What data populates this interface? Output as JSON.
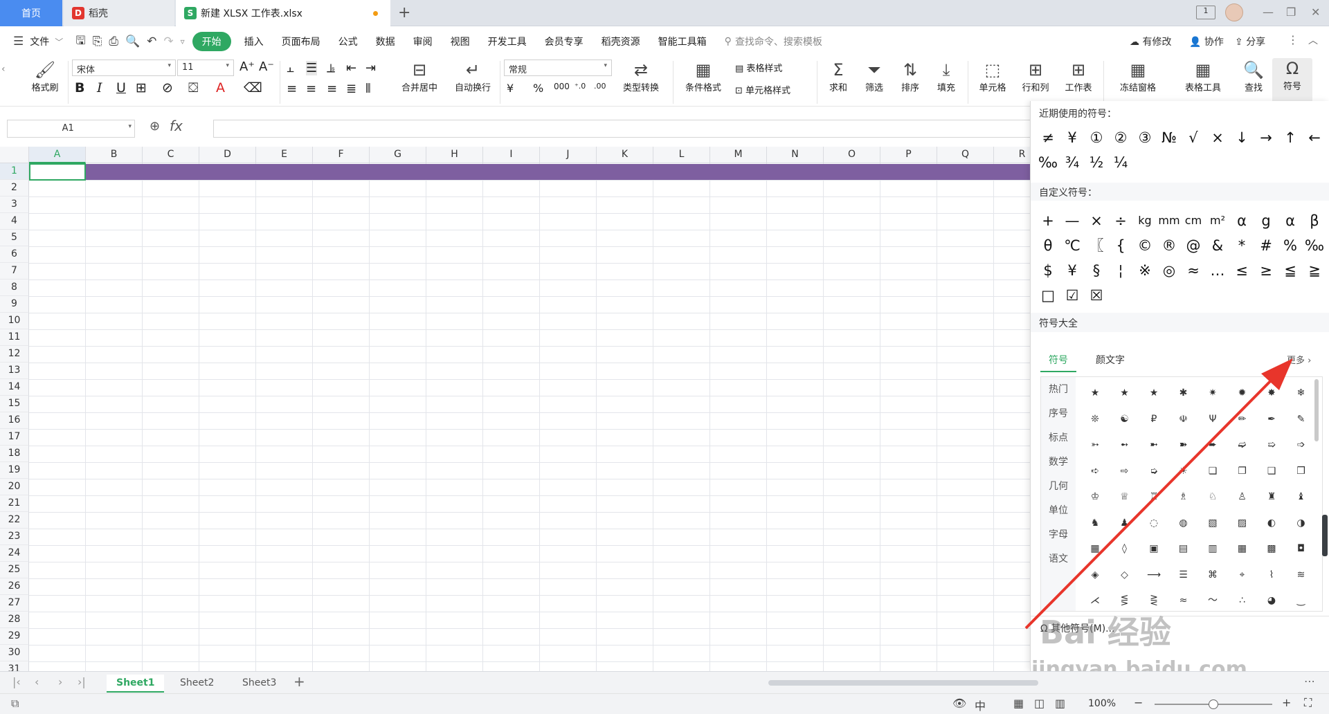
{
  "tabs": {
    "home": "首页",
    "daoke": "稻壳",
    "file": "新建 XLSX 工作表.xlsx",
    "new_tab": "+"
  },
  "menu": {
    "file": "文件",
    "items": [
      "开始",
      "插入",
      "页面布局",
      "公式",
      "数据",
      "审阅",
      "视图",
      "开发工具",
      "会员专享",
      "稻壳资源",
      "智能工具箱"
    ],
    "search_placeholder": "查找命令、搜索模板",
    "modified": "有修改",
    "collaborate": "协作",
    "share": "分享"
  },
  "ribbon": {
    "format_painter": "格式刷",
    "font_name": "宋体",
    "font_size": "11",
    "merge_center": "合并居中",
    "wrap_text": "自动换行",
    "number_format": "常规",
    "type_convert": "类型转换",
    "cond_format": "条件格式",
    "table_style": "表格样式",
    "cell_style": "单元格样式",
    "sum": "求和",
    "filter": "筛选",
    "sort": "排序",
    "fill": "填充",
    "cells": "单元格",
    "row_col": "行和列",
    "worksheet": "工作表",
    "freeze": "冻结窗格",
    "table_tools": "表格工具",
    "find": "查找",
    "symbol": "符号"
  },
  "formula": {
    "cell_ref": "A1",
    "fx": "fx",
    "value": ""
  },
  "grid": {
    "columns": [
      "A",
      "B",
      "C",
      "D",
      "E",
      "F",
      "G",
      "H",
      "I",
      "J",
      "K",
      "L",
      "M",
      "N",
      "O",
      "P",
      "Q",
      "R"
    ],
    "rows": [
      "1",
      "2",
      "3",
      "4",
      "5",
      "6",
      "7",
      "8",
      "9",
      "10",
      "11",
      "12",
      "13",
      "14",
      "15",
      "16",
      "17",
      "18",
      "19",
      "20",
      "21",
      "22",
      "23",
      "24",
      "25",
      "26",
      "27",
      "28",
      "29",
      "30",
      "31"
    ],
    "highlight_row_color": "#7e5fa0"
  },
  "panel": {
    "recent_title": "近期使用的符号：",
    "recent": [
      "≠",
      "¥",
      "①",
      "②",
      "③",
      "№",
      "√",
      "×",
      "↓",
      "→",
      "↑",
      "←",
      "‰",
      "¾",
      "½",
      "¼"
    ],
    "custom_title": "自定义符号：",
    "custom": [
      "+",
      "—",
      "×",
      "÷",
      "kg",
      "mm",
      "cm",
      "m²",
      "α",
      "g",
      "α",
      "β",
      "θ",
      "℃",
      "〖",
      "{",
      "©",
      "®",
      "@",
      "&",
      "*",
      "#",
      "%",
      "‰",
      "$",
      "¥",
      "§",
      "¦",
      "※",
      "◎",
      "≈",
      "…",
      "≤",
      "≥",
      "≦",
      "≧",
      "□",
      "☑",
      "☒"
    ],
    "all_title": "符号大全",
    "tab_symbol": "符号",
    "tab_emoticon": "颜文字",
    "more": "更多",
    "categories": [
      "热门",
      "序号",
      "标点",
      "数学",
      "几何",
      "单位",
      "字母",
      "语文"
    ],
    "grid_symbols": [
      "★",
      "★",
      "★",
      "✱",
      "✷",
      "✹",
      "✸",
      "❄",
      "❊",
      "☯",
      "₽",
      "☫",
      "Ψ",
      "✏",
      "✒",
      "✎",
      "➳",
      "➻",
      "➼",
      "➽",
      "➨",
      "➫",
      "➯",
      "➩",
      "➪",
      "⇨",
      "➭",
      "☀",
      "❏",
      "❐",
      "❑",
      "❒",
      "♔",
      "♕",
      "♖",
      "♗",
      "♘",
      "♙",
      "♜",
      "♝",
      "♞",
      "♟",
      "◌",
      "◍",
      "▧",
      "▨",
      "◐",
      "◑",
      "▦",
      "◊",
      "▣",
      "▤",
      "▥",
      "▦",
      "▩",
      "◘",
      "◈",
      "◇",
      "⟶",
      "☰",
      "⌘",
      "⌖",
      "⌇",
      "≋",
      "⋌",
      "⋚",
      "⋛",
      "≈",
      "～",
      "∴",
      "◕",
      "‿"
    ],
    "other_symbols": "其他符号(M)..."
  },
  "sheets": [
    "Sheet1",
    "Sheet2",
    "Sheet3"
  ],
  "status": {
    "zoom": "100%"
  },
  "watermark": {
    "brand": "Bai 经验",
    "url": "jingyan.baidu.com"
  },
  "colors": {
    "accent": "#2fa862",
    "home_tab": "#4a8cf0",
    "arrow": "#e8352b"
  }
}
